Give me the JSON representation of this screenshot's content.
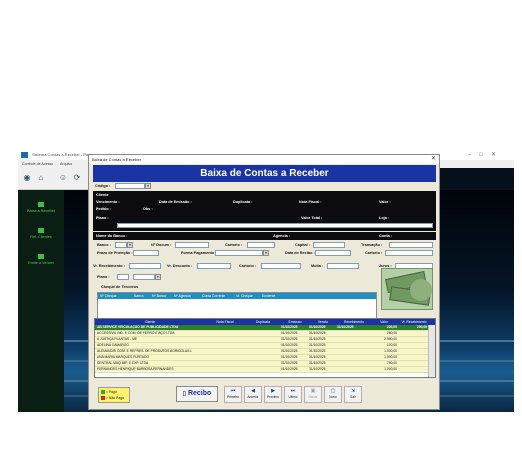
{
  "app": {
    "title": "Sistema Contas a Receber - Pagar",
    "menu": [
      "Controle de Acesso",
      "Arquivo"
    ],
    "window_controls": [
      "–",
      "□",
      "✕"
    ],
    "toolbar_icons": [
      "back-icon",
      "home-icon",
      "users-icon",
      "refresh-icon"
    ],
    "sidebar": [
      {
        "label": "Baixa a Receber",
        "icon": "money-icon"
      },
      {
        "label": "Rel. Clientes",
        "icon": "report-icon"
      },
      {
        "label": "Emitir à Vencer",
        "icon": "calendar-icon"
      }
    ]
  },
  "dialog": {
    "title": "Baixa de Contas a Receber",
    "close_label": "✕",
    "banner": "Baixa de Contas a Receber"
  },
  "form": {
    "codigo_label": "Código :",
    "combo_arrow": "▾",
    "cliente_label": "Cliente",
    "vencimento_label": "Vencimento :",
    "data_emissao_label": "Data de Emissão :",
    "duplicata_label": "Duplicata :",
    "nota_fiscal_label": "Nota Fiscal :",
    "valor_label": "Valor :",
    "pedido_label": "Pedido :",
    "obs_label": "Obs :",
    "plano_label": "Plano :",
    "valor_total_label": "Valor Total :",
    "loja_label": "Loja :",
    "nome_banco_label": "Nome do Banco :",
    "agencia_label": "Agencia :",
    "conta_label": "Conta :",
    "banco_label": "Banco :",
    "n_docum_label": "Nº Docum :",
    "cartorio_label": "Cartorio :",
    "capital_label": "Capital :",
    "transacao_label": "Transação :",
    "prazo_protesto_label": "Prazo de Proteção :",
    "forma_pagamento_label": "Forma Pagamento :",
    "data_recibo_label": "Data de Recibo :",
    "cartorio2_label": "Cartorio :",
    "vr_recebimento_label": "Vr. Recebimento :",
    "vr_desconto_label": "Vr. Desconto :",
    "cartorio3_label": "Cartorio :",
    "multa_label": "Multa :",
    "juros_label": "Juros :",
    "plano2_label": "Plano :"
  },
  "cheques": {
    "section_label": "Cheque de Terceiros",
    "columns": [
      "Nº Cheque",
      "Banco",
      "Nº Banco",
      "Nº Agencia",
      "Conta Corrente",
      "Vr. Cheque",
      "Emitente"
    ]
  },
  "grid": {
    "columns": [
      "Cliente",
      "Nota Fiscal",
      "Duplicata",
      "Emissao",
      "Vencto",
      "Recebimento",
      "Valor",
      "Vr. Recebimento"
    ],
    "rows": [
      {
        "cliente": "AB SERVICE VEICULAÇÃO DE PUBLICIDADE LTDA",
        "nota": "",
        "dup": "",
        "emissao": "01/10/2025",
        "vencto": "31/10/2025",
        "receb": "31/10/2025",
        "valor": "200,00",
        "vr_receb": "200,00",
        "selected": true
      },
      {
        "cliente": "ACCESSIVIL IND. E COM. DE FERRO E AÇO LTDA",
        "nota": "",
        "dup": "",
        "emissao": "01/10/2025",
        "vencto": "31/10/2025",
        "receb": "",
        "valor": "280,00",
        "vr_receb": "",
        "selected": false
      },
      {
        "cliente": "A JUSTIÇA PLANTAS - ME",
        "nota": "",
        "dup": "",
        "emissao": "01/10/2025",
        "vencto": "31/10/2025",
        "receb": "",
        "valor": "2.980,00",
        "vr_receb": "",
        "selected": false
      },
      {
        "cliente": "ADELINA CAMARGO",
        "nota": "",
        "dup": "",
        "emissao": "01/10/2025",
        "vencto": "31/10/2025",
        "receb": "",
        "valor": "100,00",
        "vr_receb": "",
        "selected": false
      },
      {
        "cliente": "ALEMANDRI COM. E REPRES. DE PRODUTOS AGRICOLAS L",
        "nota": "",
        "dup": "",
        "emissao": "01/10/2025",
        "vencto": "31/10/2025",
        "receb": "",
        "valor": "1.000,00",
        "vr_receb": "",
        "selected": false
      },
      {
        "cliente": "ANA MARIA MARQUES FURTADO",
        "nota": "",
        "dup": "",
        "emissao": "01/10/2025",
        "vencto": "31/10/2025",
        "receb": "",
        "valor": "1.000,00",
        "vr_receb": "",
        "selected": false
      },
      {
        "cliente": "CENTRAL MAQ IMP. E EXP. LTDA",
        "nota": "",
        "dup": "",
        "emissao": "01/10/2025",
        "vencto": "31/10/2025",
        "receb": "",
        "valor": "750,00",
        "vr_receb": "",
        "selected": false
      },
      {
        "cliente": "FERNANDES HENRIQUE BARBOSA FERNANDES",
        "nota": "",
        "dup": "",
        "emissao": "01/10/2025",
        "vencto": "31/10/2025",
        "receb": "",
        "valor": "1.000,00",
        "vr_receb": "",
        "selected": false
      }
    ]
  },
  "legend": {
    "pago": "= Pago",
    "nao_pago": "= Não Pago",
    "pago_color": "#2eaa2e",
    "nao_pago_color": "#d62828"
  },
  "buttons": {
    "recibo": "Recibo",
    "primeiro": "Primeiro",
    "anterior": "Anterior",
    "proximo": "Proximo",
    "ultimo": "Ultimo",
    "salvar": "Salvar",
    "novo": "Novo",
    "sair": "Sair"
  },
  "colors": {
    "banner": "#1a34a6",
    "selected_row": "#2f7f2a",
    "row": "#f6f6c9"
  }
}
